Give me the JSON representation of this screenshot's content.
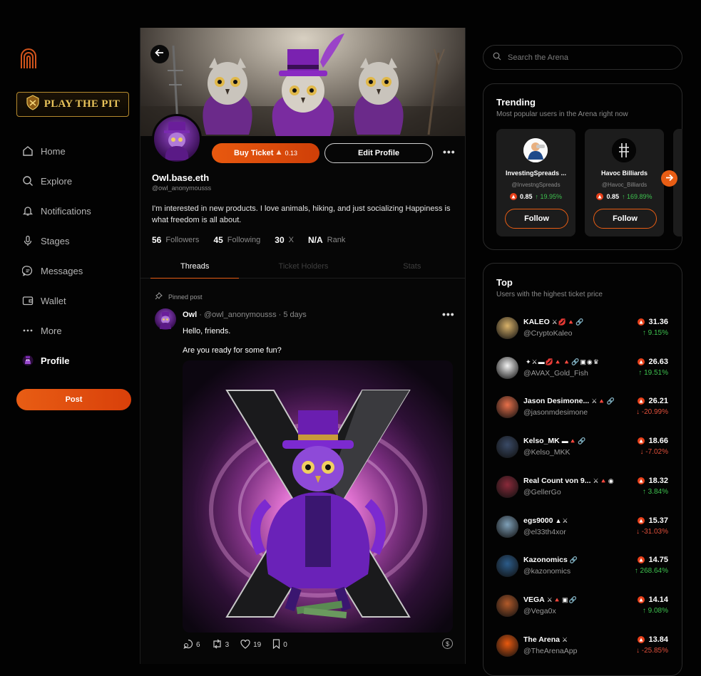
{
  "sidebar": {
    "brand_button": "PLAY THE PIT",
    "nav": [
      {
        "label": "Home",
        "icon": "home-icon"
      },
      {
        "label": "Explore",
        "icon": "search-icon"
      },
      {
        "label": "Notifications",
        "icon": "bell-icon"
      },
      {
        "label": "Stages",
        "icon": "microphone-icon"
      },
      {
        "label": "Messages",
        "icon": "message-icon"
      },
      {
        "label": "Wallet",
        "icon": "wallet-icon"
      },
      {
        "label": "More",
        "icon": "more-dots-icon"
      },
      {
        "label": "Profile",
        "icon": "profile-avatar-icon"
      }
    ],
    "post_button": "Post"
  },
  "profile": {
    "buy_label": "Buy Ticket",
    "buy_price": "0.13",
    "edit_label": "Edit Profile",
    "name": "Owl.base.eth",
    "handle": "@owl_anonymousss",
    "bio": "I'm interested in new products. I love animals, hiking, and just socializing Happiness is what freedom is all about.",
    "followers_count": "56",
    "followers_label": "Followers",
    "following_count": "45",
    "following_label": "Following",
    "x_count": "30",
    "x_label": "X",
    "rank_value": "N/A",
    "rank_label": "Rank",
    "tabs": [
      "Threads",
      "Ticket Holders",
      "Stats"
    ]
  },
  "post": {
    "pinned_label": "Pinned post",
    "author": "Owl",
    "meta": "· @owl_anonymousss · 5 days",
    "line1": "Hello, friends.",
    "line2": "Are you ready for some fun?",
    "comments": "6",
    "reposts": "3",
    "likes": "19",
    "bookmarks": "0",
    "tip_symbol": "$"
  },
  "search": {
    "placeholder": "Search the Arena"
  },
  "trending": {
    "title": "Trending",
    "subtitle": "Most popular users in the Arena right now",
    "users": [
      {
        "name": "InvestingSpreads ...",
        "handle": "@InvestngSpreads",
        "price": "0.85",
        "change": "↑ 19.95%",
        "follow": "Follow"
      },
      {
        "name": "Havoc Billiards",
        "handle": "@Havoc_Billiards",
        "price": "0.85",
        "change": "↑ 169.89%",
        "follow": "Follow"
      }
    ]
  },
  "top": {
    "title": "Top",
    "subtitle": "Users with the highest ticket price",
    "users": [
      {
        "name": "KALEO",
        "emoji": "⚔💋🔺🔗",
        "handle": "@CryptoKaleo",
        "price": "31.36",
        "change": "↑ 9.15%",
        "dir": "up",
        "color": "#d9b26a"
      },
      {
        "name": "",
        "emoji": "✦⚔▬💋🔺🔺🔗▣◉♛",
        "handle": "@AVAX_Gold_Fish",
        "price": "26.63",
        "change": "↑ 19.51%",
        "dir": "up",
        "color": "#f2f2f2"
      },
      {
        "name": "Jason Desimone...",
        "emoji": "⚔🔺🔗",
        "handle": "@jasonmdesimone",
        "price": "26.21",
        "change": "↓ -20.99%",
        "dir": "down",
        "color": "#e8704a"
      },
      {
        "name": "Kelso_MK",
        "emoji": "▬🔺🔗",
        "handle": "@Kelso_MKK",
        "price": "18.66",
        "change": "↓ -7.02%",
        "dir": "down",
        "color": "#3a4a66"
      },
      {
        "name": "Real Count von 9...",
        "emoji": "⚔🔺◉",
        "handle": "@GellerGo",
        "price": "18.32",
        "change": "↑ 3.84%",
        "dir": "up",
        "color": "#8a2a3a"
      },
      {
        "name": "egs9000",
        "emoji": "▲⚔",
        "handle": "@el33th4xor",
        "price": "15.37",
        "change": "↓ -31.03%",
        "dir": "down",
        "color": "#7fa0b8"
      },
      {
        "name": "Kazonomics",
        "emoji": "🔗",
        "handle": "@kazonomics",
        "price": "14.75",
        "change": "↑ 268.64%",
        "dir": "up",
        "color": "#2c5c8a"
      },
      {
        "name": "VEGA",
        "emoji": "⚔🔺▣🔗",
        "handle": "@Vega0x",
        "price": "14.14",
        "change": "↑ 9.08%",
        "dir": "up",
        "color": "#b25a2a"
      },
      {
        "name": "The Arena",
        "emoji": "⚔",
        "handle": "@TheArenaApp",
        "price": "13.84",
        "change": "↓ -25.85%",
        "dir": "down",
        "color": "#e8590f"
      }
    ]
  },
  "colors": {
    "accent": "#e85d14",
    "positive": "#3ec24f",
    "negative": "#e2503b"
  }
}
